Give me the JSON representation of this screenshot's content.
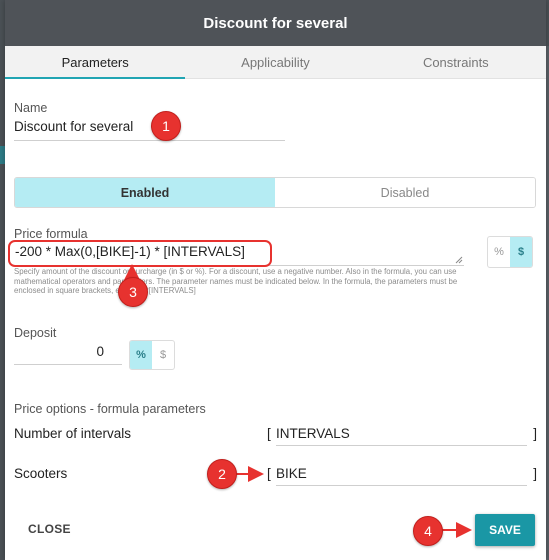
{
  "dialog": {
    "title": "Discount for several"
  },
  "tabs": [
    {
      "label": "Parameters",
      "active": true
    },
    {
      "label": "Applicability",
      "active": false
    },
    {
      "label": "Constraints",
      "active": false
    }
  ],
  "name": {
    "label": "Name",
    "value": "Discount for several"
  },
  "status_toggle": {
    "enabled_label": "Enabled",
    "disabled_label": "Disabled",
    "selected": "Enabled"
  },
  "price_formula": {
    "label": "Price formula",
    "value": "-200 * Max(0,[BIKE]-1) * [INTERVALS]",
    "hint": "Specify amount of the discount or surcharge (in $ or %). For a discount, use a negative number. Also in the formula, you can use mathematical operators and parameters. The parameter names must be indicated below. In the formula, the parameters must be enclosed in square brackets, e.g.: 100*[INTERVALS]",
    "unit_percent": "%",
    "unit_dollar": "$",
    "selected_unit": "$"
  },
  "deposit": {
    "label": "Deposit",
    "value": "0",
    "unit_percent": "%",
    "unit_dollar": "$",
    "selected_unit": "%"
  },
  "price_options": {
    "heading": "Price options - formula parameters",
    "params": [
      {
        "label": "Number of intervals",
        "open": "[",
        "value": "INTERVALS",
        "close": "]"
      },
      {
        "label": "Scooters",
        "open": "[",
        "value": "BIKE",
        "close": "]"
      }
    ]
  },
  "footer": {
    "close_label": "CLOSE",
    "save_label": "SAVE"
  },
  "annotations": [
    "1",
    "2",
    "3",
    "4"
  ],
  "colors": {
    "accent": "#1a97a5",
    "toggle_on": "#b5ecf3",
    "header": "#4f5358",
    "annotation": "#e7322f"
  }
}
